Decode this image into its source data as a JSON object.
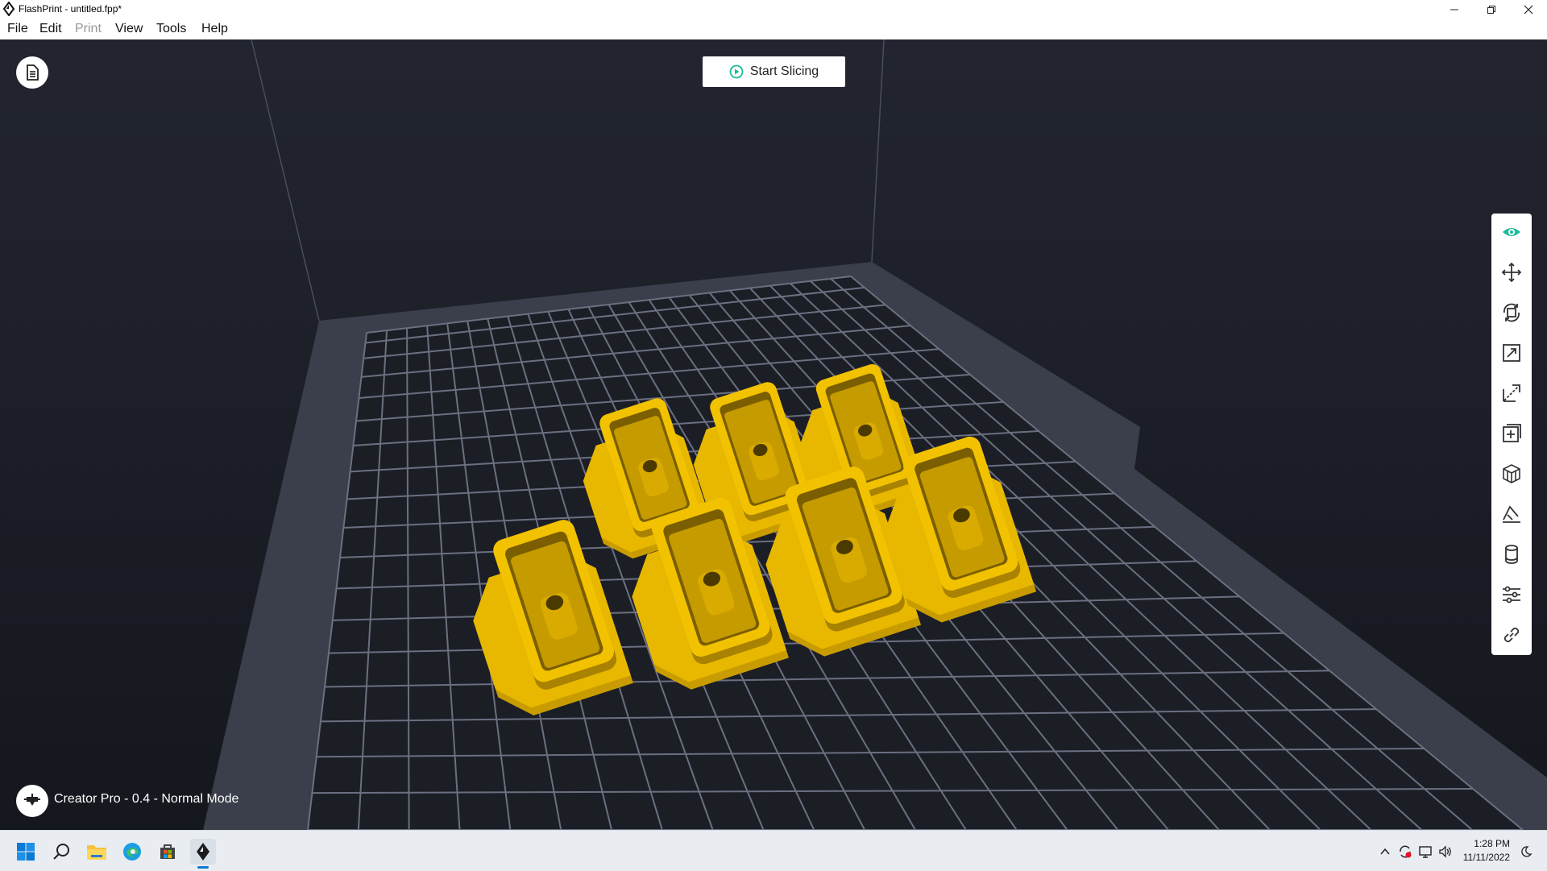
{
  "window": {
    "title": "FlashPrint - untitled.fpp*"
  },
  "menu": [
    "File",
    "Edit",
    "Print",
    "View",
    "Tools",
    "Help"
  ],
  "slice_button": {
    "label": "Start Slicing"
  },
  "printer_status": "Creator Pro - 0.4 - Normal Mode",
  "toolbar_icons": [
    "eye-icon",
    "move-icon",
    "rotate-icon",
    "scale-icon",
    "cut-icon",
    "add-object-icon",
    "supports-icon",
    "lay-flat-icon",
    "cylinder-icon",
    "settings-sliders-icon",
    "link-icon"
  ],
  "colors": {
    "viewport_bg": "#20232c",
    "model_yellow": "#e8b800",
    "accent_teal": "#1abc9c",
    "grid_line": "#6b6f80"
  },
  "models": [
    {
      "id": "part-1"
    },
    {
      "id": "part-2"
    },
    {
      "id": "part-3"
    },
    {
      "id": "part-4"
    },
    {
      "id": "part-5"
    },
    {
      "id": "part-6"
    },
    {
      "id": "part-7"
    }
  ],
  "taskbar": {
    "time": "1:28 PM",
    "date": "11/11/2022"
  }
}
